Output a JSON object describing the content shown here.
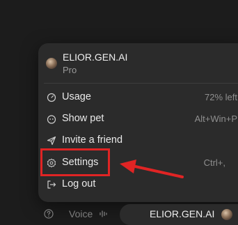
{
  "account": {
    "name": "ELIOR.GEN.AI",
    "plan": "Pro"
  },
  "menu": {
    "items": [
      {
        "label": "Usage",
        "right": "72% left",
        "icon": "gauge-icon"
      },
      {
        "label": "Show pet",
        "right": "Alt+Win+P",
        "icon": "pet-icon"
      },
      {
        "label": "Invite a friend",
        "right": "",
        "icon": "send-icon"
      },
      {
        "label": "Settings",
        "right": "Ctrl+,",
        "icon": "gear-icon"
      },
      {
        "label": "Log out",
        "right": "",
        "icon": "logout-icon"
      }
    ]
  },
  "bottom_bar": {
    "voice_label": "Voice",
    "account_name": "ELIOR.GEN.AI"
  },
  "colors": {
    "background": "#1c1c1c",
    "menu": "#2b2b2b",
    "annotation": "#e02424"
  }
}
